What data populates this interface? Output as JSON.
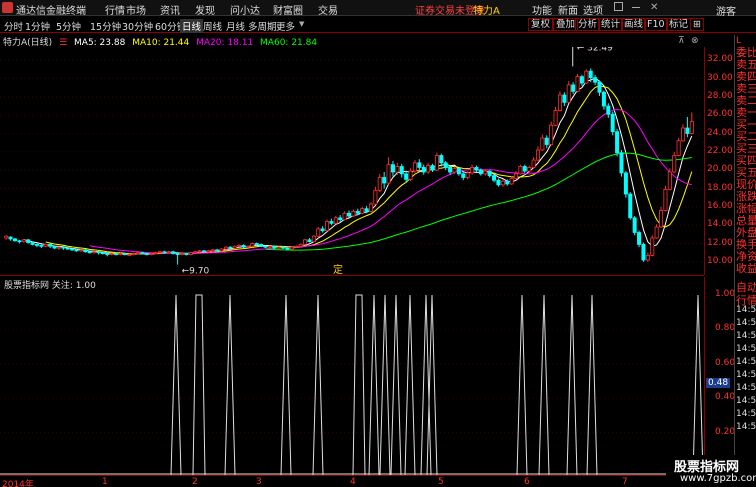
{
  "app": {
    "title": "通达信金融终端"
  },
  "menu": [
    "行情",
    "市场",
    "资讯",
    "发现",
    "问小达",
    "财富圈",
    "交易"
  ],
  "menu_right": [
    "功能",
    "新面",
    "选项"
  ],
  "warning": "证券交易未登录",
  "stock_name": "特力A",
  "guest": "游客",
  "periods": [
    "分时",
    "1分钟",
    "5分钟",
    "15分钟",
    "30分钟",
    "60分钟",
    "日线",
    "周线",
    "月线",
    "多周期",
    "更多"
  ],
  "active_period": "日线",
  "toolbar_right": [
    "复权",
    "叠加",
    "分析",
    "统计",
    "画线",
    "F10",
    "标记"
  ],
  "info": {
    "name": "特力A(日线)",
    "ma5": "MA5: 23.88",
    "ma10": "MA10: 21.44",
    "ma20": "MA20: 18.11",
    "ma60": "MA60: 21.84"
  },
  "colors": {
    "ma5": "#ffffff",
    "ma10": "#ffff00",
    "ma20": "#ff00ff",
    "ma60": "#00ff00",
    "up": "#ff3030",
    "down": "#00ffff"
  },
  "annotations": {
    "high": "32.49",
    "low": "9.70",
    "event_mark": "定"
  },
  "y_main": [
    "32.00",
    "30.00",
    "28.00",
    "26.00",
    "24.00",
    "22.00",
    "20.00",
    "18.00",
    "16.00",
    "14.00",
    "12.00",
    "10.00"
  ],
  "indicator": {
    "title": "股票指标网 关注: 1.00",
    "current": "0.48"
  },
  "y_ind": [
    "1.00",
    "0.80",
    "0.60",
    "0.40",
    "0.20"
  ],
  "x_labels": [
    "2014年",
    "1",
    "2",
    "3",
    "4",
    "5",
    "6",
    "7"
  ],
  "right_col_top": [
    "L",
    "委比",
    "卖五",
    "卖四",
    "卖三",
    "卖二",
    "卖一",
    "买一",
    "买二",
    "买三",
    "买四",
    "买五",
    "现价",
    "涨跌",
    "涨幅",
    "总量",
    "外盘",
    "换手",
    "净资",
    "收益"
  ],
  "right_col_bottom": [
    "自动",
    "行情",
    "14:55",
    "14:55",
    "14:55",
    "14:56",
    "14:56",
    "14:56",
    "14:56",
    "14:56",
    "14:56",
    "14:56"
  ],
  "watermark": {
    "line1": "股票指标网",
    "line2": "www.7gpzb.com"
  },
  "chart_data": {
    "type": "candlestick",
    "ylim": [
      9,
      33
    ],
    "candles": [
      [
        12.6,
        12.8,
        12.4,
        12.9
      ],
      [
        12.7,
        12.5,
        12.3,
        12.8
      ],
      [
        12.5,
        12.3,
        12.2,
        12.6
      ],
      [
        12.3,
        12.2,
        12.0,
        12.4
      ],
      [
        12.2,
        12.4,
        12.1,
        12.5
      ],
      [
        12.4,
        12.1,
        12.0,
        12.5
      ],
      [
        12.1,
        11.9,
        11.8,
        12.2
      ],
      [
        11.9,
        11.8,
        11.6,
        12.0
      ],
      [
        11.8,
        11.7,
        11.5,
        11.9
      ],
      [
        11.7,
        11.9,
        11.6,
        12.0
      ],
      [
        11.9,
        11.7,
        11.5,
        12.0
      ],
      [
        11.7,
        11.5,
        11.4,
        11.8
      ],
      [
        11.5,
        11.6,
        11.3,
        11.7
      ],
      [
        11.6,
        11.5,
        11.3,
        11.7
      ],
      [
        11.5,
        11.4,
        11.3,
        11.6
      ],
      [
        11.4,
        11.3,
        11.2,
        11.5
      ],
      [
        11.3,
        11.2,
        11.1,
        11.4
      ],
      [
        11.2,
        11.3,
        11.1,
        11.4
      ],
      [
        11.3,
        11.1,
        11.0,
        11.4
      ],
      [
        11.1,
        11.0,
        10.9,
        11.2
      ],
      [
        11.0,
        11.1,
        10.9,
        11.2
      ],
      [
        11.1,
        11.0,
        10.8,
        11.2
      ],
      [
        11.0,
        10.9,
        10.8,
        11.1
      ],
      [
        10.9,
        10.8,
        10.6,
        11.0
      ],
      [
        10.8,
        10.9,
        10.7,
        11.0
      ],
      [
        10.9,
        10.8,
        10.7,
        11.0
      ],
      [
        10.8,
        10.9,
        10.7,
        11.0
      ],
      [
        10.9,
        10.8,
        10.7,
        11.0
      ],
      [
        10.8,
        10.8,
        10.7,
        10.9
      ],
      [
        10.8,
        10.9,
        10.7,
        11.0
      ],
      [
        10.9,
        11.0,
        10.8,
        11.1
      ],
      [
        11.0,
        10.9,
        10.8,
        11.1
      ],
      [
        10.9,
        10.8,
        10.7,
        11.0
      ],
      [
        10.8,
        10.9,
        10.7,
        11.0
      ],
      [
        10.9,
        11.0,
        10.8,
        11.1
      ],
      [
        11.0,
        11.1,
        10.9,
        11.2
      ],
      [
        11.1,
        11.0,
        10.9,
        11.2
      ],
      [
        11.0,
        11.1,
        10.9,
        11.2
      ],
      [
        11.1,
        10.9,
        10.8,
        11.2
      ],
      [
        10.9,
        10.8,
        9.7,
        11.0
      ],
      [
        10.8,
        10.9,
        10.7,
        11.0
      ],
      [
        10.9,
        10.8,
        10.7,
        11.0
      ],
      [
        10.8,
        11.0,
        10.7,
        11.1
      ],
      [
        11.0,
        11.1,
        10.9,
        11.2
      ],
      [
        11.1,
        11.2,
        11.0,
        11.3
      ],
      [
        11.2,
        11.1,
        11.0,
        11.3
      ],
      [
        11.1,
        11.2,
        11.0,
        11.3
      ],
      [
        11.2,
        11.3,
        11.1,
        11.4
      ],
      [
        11.3,
        11.2,
        11.1,
        11.4
      ],
      [
        11.2,
        11.4,
        11.1,
        11.5
      ],
      [
        11.4,
        11.6,
        11.3,
        11.7
      ],
      [
        11.6,
        11.5,
        11.4,
        11.7
      ],
      [
        11.5,
        11.7,
        11.4,
        11.8
      ],
      [
        11.7,
        11.8,
        11.6,
        11.9
      ],
      [
        11.8,
        11.6,
        11.5,
        11.9
      ],
      [
        11.6,
        11.7,
        11.5,
        11.8
      ],
      [
        11.7,
        12.0,
        11.6,
        12.1
      ],
      [
        12.0,
        11.9,
        11.8,
        12.1
      ],
      [
        11.9,
        11.7,
        11.6,
        12.0
      ],
      [
        11.7,
        11.6,
        11.5,
        11.8
      ],
      [
        11.6,
        11.7,
        11.5,
        11.8
      ],
      [
        11.7,
        11.5,
        11.4,
        11.8
      ],
      [
        11.5,
        11.6,
        11.4,
        11.7
      ],
      [
        11.6,
        11.5,
        11.4,
        11.7
      ],
      [
        11.5,
        11.4,
        11.3,
        11.6
      ],
      [
        11.4,
        11.6,
        11.3,
        11.7
      ],
      [
        11.6,
        11.7,
        11.5,
        11.8
      ],
      [
        11.7,
        11.9,
        11.6,
        12.0
      ],
      [
        11.9,
        12.4,
        11.8,
        12.5
      ],
      [
        12.4,
        12.2,
        12.1,
        12.6
      ],
      [
        12.2,
        12.8,
        12.1,
        12.9
      ],
      [
        12.8,
        13.6,
        12.7,
        13.8
      ],
      [
        13.6,
        13.4,
        13.2,
        13.9
      ],
      [
        13.4,
        14.4,
        13.3,
        14.6
      ],
      [
        14.4,
        14.2,
        14.0,
        14.7
      ],
      [
        14.2,
        14.8,
        14.1,
        15.0
      ],
      [
        14.8,
        14.6,
        14.3,
        15.1
      ],
      [
        14.6,
        15.3,
        14.5,
        15.5
      ],
      [
        15.3,
        15.0,
        14.8,
        15.6
      ],
      [
        15.0,
        15.5,
        14.9,
        15.7
      ],
      [
        15.5,
        15.3,
        15.1,
        15.8
      ],
      [
        15.3,
        15.8,
        15.2,
        16.0
      ],
      [
        15.8,
        15.5,
        15.3,
        16.1
      ],
      [
        15.5,
        16.3,
        15.4,
        16.5
      ],
      [
        16.3,
        17.8,
        16.2,
        18.2
      ],
      [
        17.8,
        19.2,
        17.6,
        19.6
      ],
      [
        19.2,
        18.6,
        18.0,
        19.8
      ],
      [
        18.6,
        20.6,
        18.4,
        21.4
      ],
      [
        20.6,
        19.8,
        19.3,
        21.0
      ],
      [
        19.8,
        20.4,
        19.5,
        20.8
      ],
      [
        20.4,
        19.6,
        19.2,
        20.7
      ],
      [
        19.6,
        19.0,
        18.6,
        19.9
      ],
      [
        19.0,
        19.9,
        18.8,
        20.2
      ],
      [
        19.9,
        20.8,
        19.7,
        21.1
      ],
      [
        20.8,
        20.3,
        20.0,
        21.2
      ],
      [
        20.3,
        19.8,
        19.5,
        20.6
      ],
      [
        19.8,
        20.5,
        19.6,
        20.8
      ],
      [
        20.5,
        20.0,
        19.8,
        20.7
      ],
      [
        20.0,
        21.6,
        19.9,
        21.9
      ],
      [
        21.6,
        20.8,
        20.4,
        21.8
      ],
      [
        20.8,
        20.3,
        20.0,
        21.0
      ],
      [
        20.3,
        19.8,
        19.5,
        20.5
      ],
      [
        19.8,
        20.2,
        19.6,
        20.4
      ],
      [
        20.2,
        19.6,
        19.4,
        20.3
      ],
      [
        19.6,
        19.2,
        18.9,
        19.8
      ],
      [
        19.2,
        19.7,
        19.0,
        19.9
      ],
      [
        19.7,
        20.3,
        19.5,
        20.6
      ],
      [
        20.3,
        20.0,
        19.8,
        20.5
      ],
      [
        20.0,
        19.6,
        19.4,
        20.2
      ],
      [
        19.6,
        19.9,
        19.4,
        20.1
      ],
      [
        19.9,
        19.4,
        19.2,
        20.0
      ],
      [
        19.4,
        18.9,
        18.7,
        19.6
      ],
      [
        18.9,
        18.4,
        18.2,
        19.1
      ],
      [
        18.4,
        18.8,
        18.2,
        19.0
      ],
      [
        18.8,
        18.5,
        18.3,
        19.0
      ],
      [
        18.5,
        19.1,
        18.4,
        19.3
      ],
      [
        19.1,
        19.6,
        19.0,
        19.9
      ],
      [
        19.6,
        20.4,
        19.5,
        20.6
      ],
      [
        20.4,
        19.9,
        19.7,
        20.6
      ],
      [
        19.9,
        20.3,
        19.7,
        20.5
      ],
      [
        20.3,
        21.1,
        20.2,
        21.4
      ],
      [
        21.1,
        22.2,
        21.0,
        22.6
      ],
      [
        22.2,
        23.5,
        22.1,
        23.9
      ],
      [
        23.5,
        22.8,
        22.4,
        23.8
      ],
      [
        22.8,
        24.9,
        22.7,
        25.3
      ],
      [
        24.9,
        26.5,
        24.8,
        26.9
      ],
      [
        26.5,
        28.2,
        26.4,
        28.6
      ],
      [
        28.2,
        27.4,
        27.0,
        28.5
      ],
      [
        27.4,
        29.3,
        27.3,
        29.7
      ],
      [
        29.3,
        28.6,
        28.3,
        29.6
      ],
      [
        28.6,
        30.2,
        28.5,
        30.5
      ],
      [
        30.2,
        29.5,
        29.2,
        30.4
      ],
      [
        29.5,
        30.8,
        29.4,
        31.0
      ],
      [
        30.8,
        30.1,
        29.6,
        31.1
      ],
      [
        30.1,
        29.6,
        29.3,
        30.4
      ],
      [
        29.6,
        28.5,
        28.1,
        29.8
      ],
      [
        28.5,
        27.0,
        26.6,
        28.7
      ],
      [
        27.0,
        26.1,
        25.7,
        27.3
      ],
      [
        26.1,
        24.2,
        23.8,
        26.4
      ],
      [
        24.2,
        21.9,
        21.5,
        24.5
      ],
      [
        21.9,
        19.7,
        19.3,
        22.2
      ],
      [
        19.7,
        17.4,
        17.0,
        19.9
      ],
      [
        17.4,
        14.8,
        14.6,
        17.6
      ],
      [
        14.8,
        13.2,
        12.9,
        15.0
      ],
      [
        13.2,
        11.9,
        11.6,
        13.4
      ],
      [
        11.9,
        10.2,
        10.0,
        12.1
      ],
      [
        10.2,
        10.7,
        10.0,
        11.0
      ],
      [
        10.7,
        12.6,
        10.6,
        12.9
      ],
      [
        12.6,
        13.8,
        12.5,
        14.1
      ],
      [
        13.8,
        15.6,
        13.7,
        16.0
      ],
      [
        15.6,
        17.9,
        15.5,
        18.3
      ],
      [
        17.9,
        19.8,
        17.8,
        20.2
      ],
      [
        19.8,
        21.6,
        19.7,
        22.0
      ],
      [
        21.6,
        23.2,
        21.5,
        23.5
      ],
      [
        23.2,
        24.6,
        23.1,
        25.0
      ],
      [
        24.6,
        24.0,
        23.6,
        25.8
      ],
      [
        24.0,
        25.3,
        23.9,
        26.3
      ]
    ]
  }
}
